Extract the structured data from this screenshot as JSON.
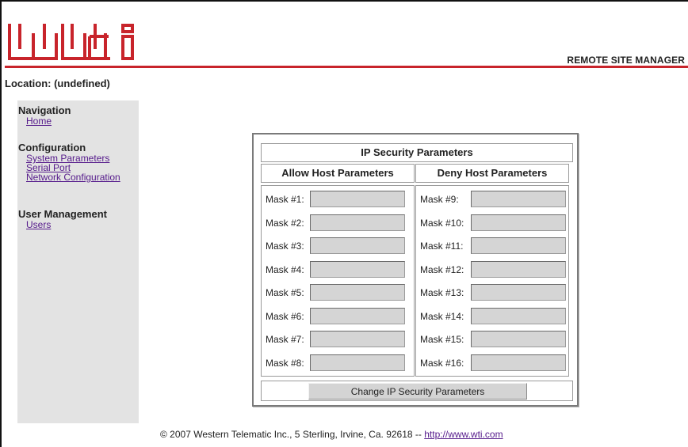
{
  "header": {
    "logo_alt": "wti",
    "tagline": "REMOTE SITE MANAGER",
    "brand_color": "#c8242b"
  },
  "location": "Location: (undefined)",
  "sidebar": {
    "sections": [
      {
        "title": "Navigation",
        "links": [
          "Home"
        ]
      },
      {
        "title": "Configuration",
        "links": [
          "System Parameters",
          "Serial Port",
          "Network Configuration"
        ]
      },
      {
        "title": "User Management",
        "links": [
          "Users"
        ]
      }
    ]
  },
  "ip_security": {
    "title": "IP Security Parameters",
    "allow_header": "Allow Host Parameters",
    "deny_header": "Deny Host Parameters",
    "allow_masks": [
      {
        "label": "Mask #1:",
        "value": ""
      },
      {
        "label": "Mask #2:",
        "value": ""
      },
      {
        "label": "Mask #3:",
        "value": ""
      },
      {
        "label": "Mask #4:",
        "value": ""
      },
      {
        "label": "Mask #5:",
        "value": ""
      },
      {
        "label": "Mask #6:",
        "value": ""
      },
      {
        "label": "Mask #7:",
        "value": ""
      },
      {
        "label": "Mask #8:",
        "value": ""
      }
    ],
    "deny_masks": [
      {
        "label": "Mask #9:",
        "value": ""
      },
      {
        "label": "Mask #10:",
        "value": ""
      },
      {
        "label": "Mask #11:",
        "value": ""
      },
      {
        "label": "Mask #12:",
        "value": ""
      },
      {
        "label": "Mask #13:",
        "value": ""
      },
      {
        "label": "Mask #14:",
        "value": ""
      },
      {
        "label": "Mask #15:",
        "value": ""
      },
      {
        "label": "Mask #16:",
        "value": ""
      }
    ],
    "submit_label": "Change IP Security Parameters"
  },
  "footer": {
    "text": "© 2007 Western Telematic Inc., 5 Sterling, Irvine, Ca. 92618 -- ",
    "link": "http://www.wti.com"
  }
}
